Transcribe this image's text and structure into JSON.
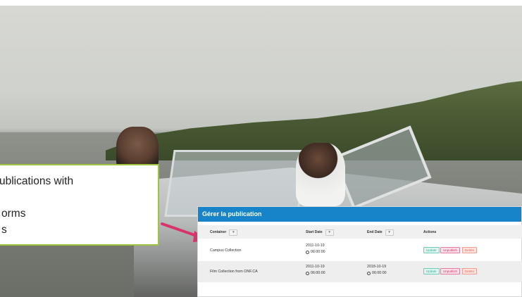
{
  "callout": {
    "lines": [
      "ublications with",
      "",
      "orms",
      "s"
    ]
  },
  "panel": {
    "title": "Gérer la publication",
    "columns": {
      "container": "Container",
      "start": "Start Date",
      "end": "End Date",
      "actions": "Actions"
    },
    "rows": [
      {
        "container": "Campus Collection",
        "start_date": "2011-10-19",
        "start_time": "06:00:00",
        "end_date": "",
        "end_time": "",
        "buttons": [
          "Update",
          "Unpublish",
          "Delete"
        ]
      },
      {
        "container": "Film Collection from ONF.CA",
        "start_date": "2011-10-19",
        "start_time": "06:00:00",
        "end_date": "2018-10-19",
        "end_time": "06:00:00",
        "buttons": [
          "Update",
          "Unpublish",
          "Delete"
        ]
      }
    ]
  },
  "colors": {
    "header": "#1783c9",
    "callout_border": "#9dc43a",
    "arrow": "#d8336b"
  }
}
